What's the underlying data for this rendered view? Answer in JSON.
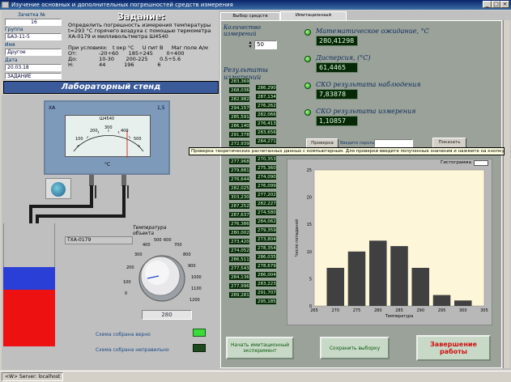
{
  "window": {
    "title": "Изучение основных и дополнительных погрешностей средств измерения",
    "status_bar": "<W> Server: localhost"
  },
  "left": {
    "group_fields": [
      {
        "label": "Зачетка №",
        "value": "16"
      },
      {
        "label": "Группа",
        "value": "БАЗ-11-5"
      },
      {
        "label": "Имя",
        "value": "Другое"
      },
      {
        "label": "Дата",
        "value": "20.03.18"
      },
      {
        "label": "",
        "value": "ЗАДАНИЕ"
      }
    ],
    "task": {
      "title": "Задание:",
      "text": "Определить погрешность измерения температуры\nt=293 °С горячего воздуха с помощью термометра\nХА-0179 и милливольтметра Ш4540\n\nПри условиях:   t окр °С     U пит В     Маг поле А/м\nОт:             -20÷60      185÷245        0÷400\nДо:             10-30       200-225       0.5÷5.6\nН:               44           196              6"
    },
    "stand_title": "Лабораторный стенд",
    "meter": {
      "type_left": "ХА",
      "type_right": "1,5",
      "model": "Ш4540",
      "unit": "°С",
      "scale_labels": [
        "100",
        "200",
        "300",
        "400",
        "500"
      ]
    },
    "thermocouple_label": "ТХА-0179",
    "knob": {
      "title": "Температура объекта",
      "scale": [
        "0",
        "100",
        "200",
        "300",
        "400",
        "500",
        "600",
        "700",
        "800",
        "900",
        "1000",
        "1100",
        "1200"
      ],
      "value": "280"
    },
    "indicators": [
      {
        "label": "Схема собрана верно",
        "state": "on"
      },
      {
        "label": "Схема собрана неправильно",
        "state": "off"
      }
    ]
  },
  "tabs": [
    {
      "label": "Выбор средств измерения",
      "active": false
    },
    {
      "label": "Имитационный эксперимент",
      "active": true
    }
  ],
  "experiment": {
    "count_label": "Количество измерений",
    "count_value": "50",
    "results_label": "Результаты измерений",
    "col1": [
      "283,369",
      "268,036",
      "282,982",
      "294,157",
      "285,591",
      "286,140",
      "291,378",
      "272,939",
      "272,375",
      "277,968",
      "279,881",
      "276,644",
      "282,025",
      "303,230",
      "287,252",
      "287,637",
      "276,386",
      "280,002",
      "273,420",
      "274,052",
      "286,511",
      "277,543",
      "284,136",
      "277,996",
      "289,281"
    ],
    "col2": [
      "286,290",
      "287,134",
      "276,262",
      "282,066",
      "276,413",
      "283,656",
      "284,271",
      "280,712",
      "270,353",
      "275,360",
      "274,090",
      "276,099",
      "277,202",
      "282,227",
      "274,580",
      "284,062",
      "279,359",
      "273,804",
      "278,354",
      "286,035",
      "278,679",
      "286,004",
      "283,223",
      "291,707",
      "295,185"
    ],
    "stats": [
      {
        "label": "Математическое ожидание, °С",
        "value": "280,41298"
      },
      {
        "label": "Дисперсия, (°С)",
        "value": "61,4465"
      },
      {
        "label": "СКО результата наблюдения",
        "value": "7,83878"
      },
      {
        "label": "СКО результата измерения",
        "value": "1,10857"
      }
    ],
    "check_button": "Проверка",
    "password_label": "Введите пароль",
    "show_button": "Показать",
    "tooltip": "Проверка теоретических расчетанных данных с компьютерным. Для проверки введите полученные значения и нажмите на кнопку \"Проверка\"",
    "histogram_label": "Гистограмма"
  },
  "chart_data": {
    "type": "bar",
    "categories": [
      "270",
      "275",
      "280",
      "285",
      "290",
      "295",
      "300"
    ],
    "values": [
      7,
      10,
      12,
      11,
      7,
      2,
      1
    ],
    "title": "",
    "xlabel": "Температура",
    "ylabel": "Число попаданий",
    "ylim": [
      0,
      25
    ],
    "xlim": [
      265,
      305
    ],
    "x_ticks": [
      "265",
      "270",
      "275",
      "280",
      "285",
      "290",
      "295",
      "300",
      "305"
    ],
    "y_ticks": [
      "0",
      "5",
      "10",
      "15",
      "20",
      "25"
    ],
    "bar_color": "#404040",
    "background": "#fdf6d8"
  },
  "buttons": {
    "start": "Начать имитационный эксперимент",
    "save": "Сохранить выборку",
    "finish": "Завершение работы"
  }
}
